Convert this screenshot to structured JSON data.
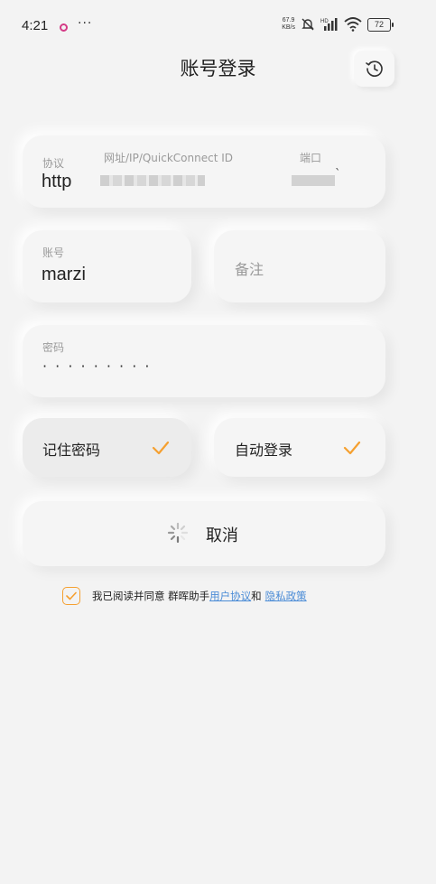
{
  "status_bar": {
    "time": "4:21",
    "more": "···",
    "net_speed_value": "67.9",
    "net_speed_unit": "KB/s",
    "signal_label": "HD",
    "battery": "72",
    "colors": {
      "notif_dot": "#d43a86"
    }
  },
  "header": {
    "title": "账号登录",
    "history_icon": "history-clock-icon"
  },
  "server": {
    "protocol_label": "协议",
    "protocol_value": "http",
    "address_label": "网址/IP/QuickConnect ID",
    "port_label": "端口",
    "port_tail": "`"
  },
  "account": {
    "label": "账号",
    "value": "marzi",
    "remark_placeholder": "备注"
  },
  "password": {
    "label": "密码",
    "value": "· · · · · · · · ·"
  },
  "options": {
    "remember_label": "记住密码",
    "remember_checked": true,
    "autologin_label": "自动登录",
    "autologin_checked": true,
    "check_icon": "checkmark-icon",
    "accent_color": "#f5a030"
  },
  "cancel_button": {
    "label": "取消",
    "spinner_icon": "loading-spinner-icon"
  },
  "agreement": {
    "checked": true,
    "prefix": "我已阅读并同意 群晖助手",
    "user_agreement": "用户协议",
    "and": "和",
    "privacy_policy": "隐私政策",
    "link_color": "#4a8bd6"
  }
}
